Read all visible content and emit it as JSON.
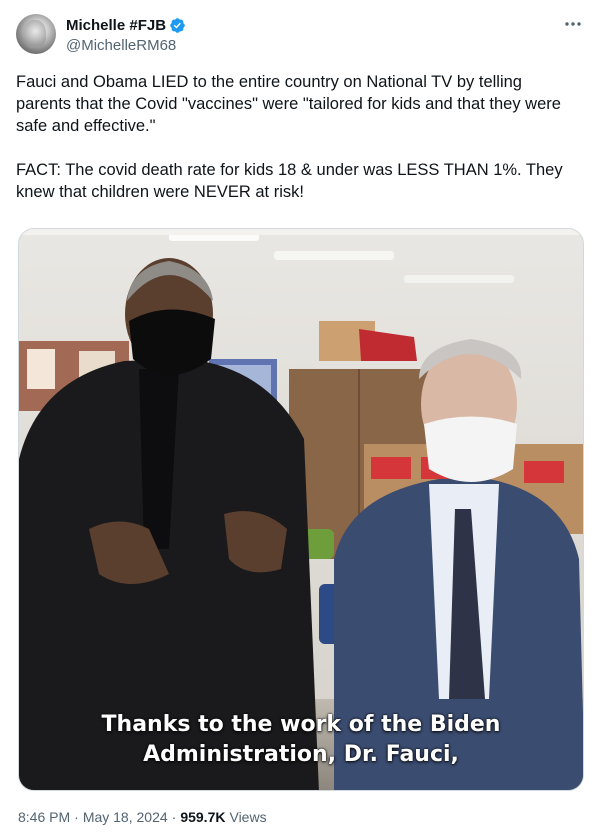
{
  "author": {
    "name": "Michelle #FJB",
    "handle": "@MichelleRM68",
    "verified_color": "#1d9bf0"
  },
  "tweet": {
    "paragraphs": [
      "Fauci and Obama LIED to the entire country on National TV by telling parents that the Covid \"vaccines\" were \"tailored for kids and that they were safe and effective.\"",
      "FACT: The covid death rate for kids 18 & under was LESS THAN 1%. They knew that children were NEVER at risk!"
    ]
  },
  "media": {
    "caption_line1": "Thanks to the work of the Biden",
    "caption_line2": "Administration, Dr. Fauci,"
  },
  "meta": {
    "time": "8:46 PM",
    "separator1": "·",
    "date": "May 18, 2024",
    "separator2": "·",
    "views_count": "959.7K",
    "views_label": "Views"
  },
  "icons": {
    "more": "more-options-icon",
    "verified": "verified-badge-icon"
  }
}
